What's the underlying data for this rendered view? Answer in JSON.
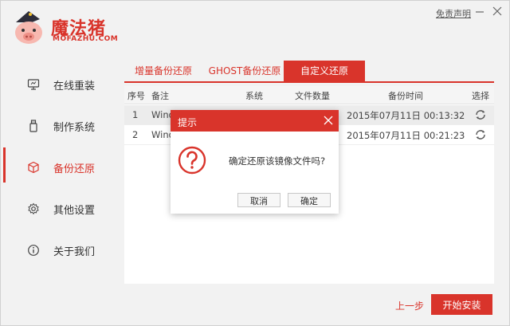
{
  "app": {
    "logo_cn": "魔法猪",
    "logo_en": "MOFAZHU.COM",
    "disclaimer": "免责声明"
  },
  "sidebar": {
    "items": [
      {
        "label": "在线重装",
        "icon": "monitor-icon"
      },
      {
        "label": "制作系统",
        "icon": "usb-drive-icon"
      },
      {
        "label": "备份还原",
        "icon": "backup-cube-icon",
        "active": true
      },
      {
        "label": "其他设置",
        "icon": "gear-icon"
      },
      {
        "label": "关于我们",
        "icon": "info-icon"
      }
    ]
  },
  "tabs": [
    {
      "label": "增量备份还原"
    },
    {
      "label": "GHOST备份还原"
    },
    {
      "label": "自定义还原",
      "active": true
    }
  ],
  "table": {
    "headers": [
      "序号",
      "备注",
      "系统",
      "文件数量",
      "备份时间",
      "选择"
    ],
    "rows": [
      {
        "index": "1",
        "note": "Wind",
        "time": "2015年07月11日 00:13:32"
      },
      {
        "index": "2",
        "note": "Wind",
        "time": "2015年07月11日 00:21:23"
      }
    ]
  },
  "footer": {
    "prev_label": "上一步",
    "start_label": "开始安装"
  },
  "dialog": {
    "title": "提示",
    "message": "确定还原该镜像文件吗?",
    "cancel_label": "取消",
    "ok_label": "确定"
  },
  "colors": {
    "accent": "#d9342b",
    "background": "#f2f2f2"
  }
}
